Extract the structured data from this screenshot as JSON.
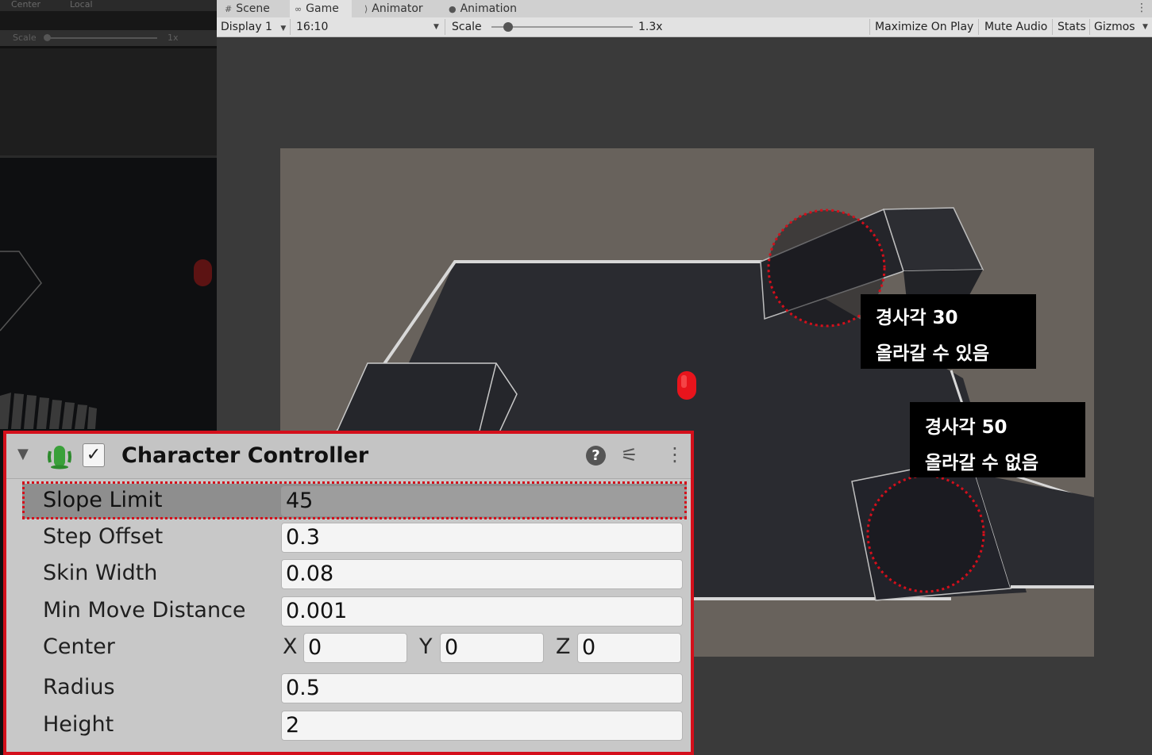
{
  "left_panel": {
    "toolbar_center": "Center",
    "toolbar_local": "Local",
    "scale_label": "Scale",
    "scale_value": "1x"
  },
  "tabs": [
    {
      "label": "Scene",
      "icon": "grid-icon"
    },
    {
      "label": "Game",
      "icon": "gamepad-icon",
      "active": true
    },
    {
      "label": "Animator",
      "icon": "animator-icon"
    },
    {
      "label": "Animation",
      "icon": "animation-clock-icon"
    }
  ],
  "game_toolbar": {
    "display": "Display 1",
    "aspect": "16:10",
    "scale_label": "Scale",
    "scale_value": "1.3x",
    "scale_fraction": 0.12,
    "maximize_on_play": "Maximize On Play",
    "mute_audio": "Mute Audio",
    "stats": "Stats",
    "gizmos": "Gizmos"
  },
  "annotations": {
    "slope_30_line1": "경사각 30",
    "slope_30_line2": "올라갈 수 있음",
    "slope_50_line1": "경사각 50",
    "slope_50_line2": "올라갈 수 없음"
  },
  "inspector": {
    "component_title": "Character Controller",
    "enabled": true,
    "help_glyph": "?",
    "properties": [
      {
        "label": "Slope Limit",
        "value": "45"
      },
      {
        "label": "Step Offset",
        "value": "0.3"
      },
      {
        "label": "Skin Width",
        "value": "0.08"
      },
      {
        "label": "Min Move Distance",
        "value": "0.001"
      },
      {
        "label": "Center",
        "x": "0",
        "y": "0",
        "z": "0",
        "x_label": "X",
        "y_label": "Y",
        "z_label": "Z"
      },
      {
        "label": "Radius",
        "value": "0.5"
      },
      {
        "label": "Height",
        "value": "2"
      }
    ]
  },
  "colors": {
    "highlight_red": "#d40f1b",
    "player_red": "#e8141c",
    "game_background": "#68625c"
  }
}
